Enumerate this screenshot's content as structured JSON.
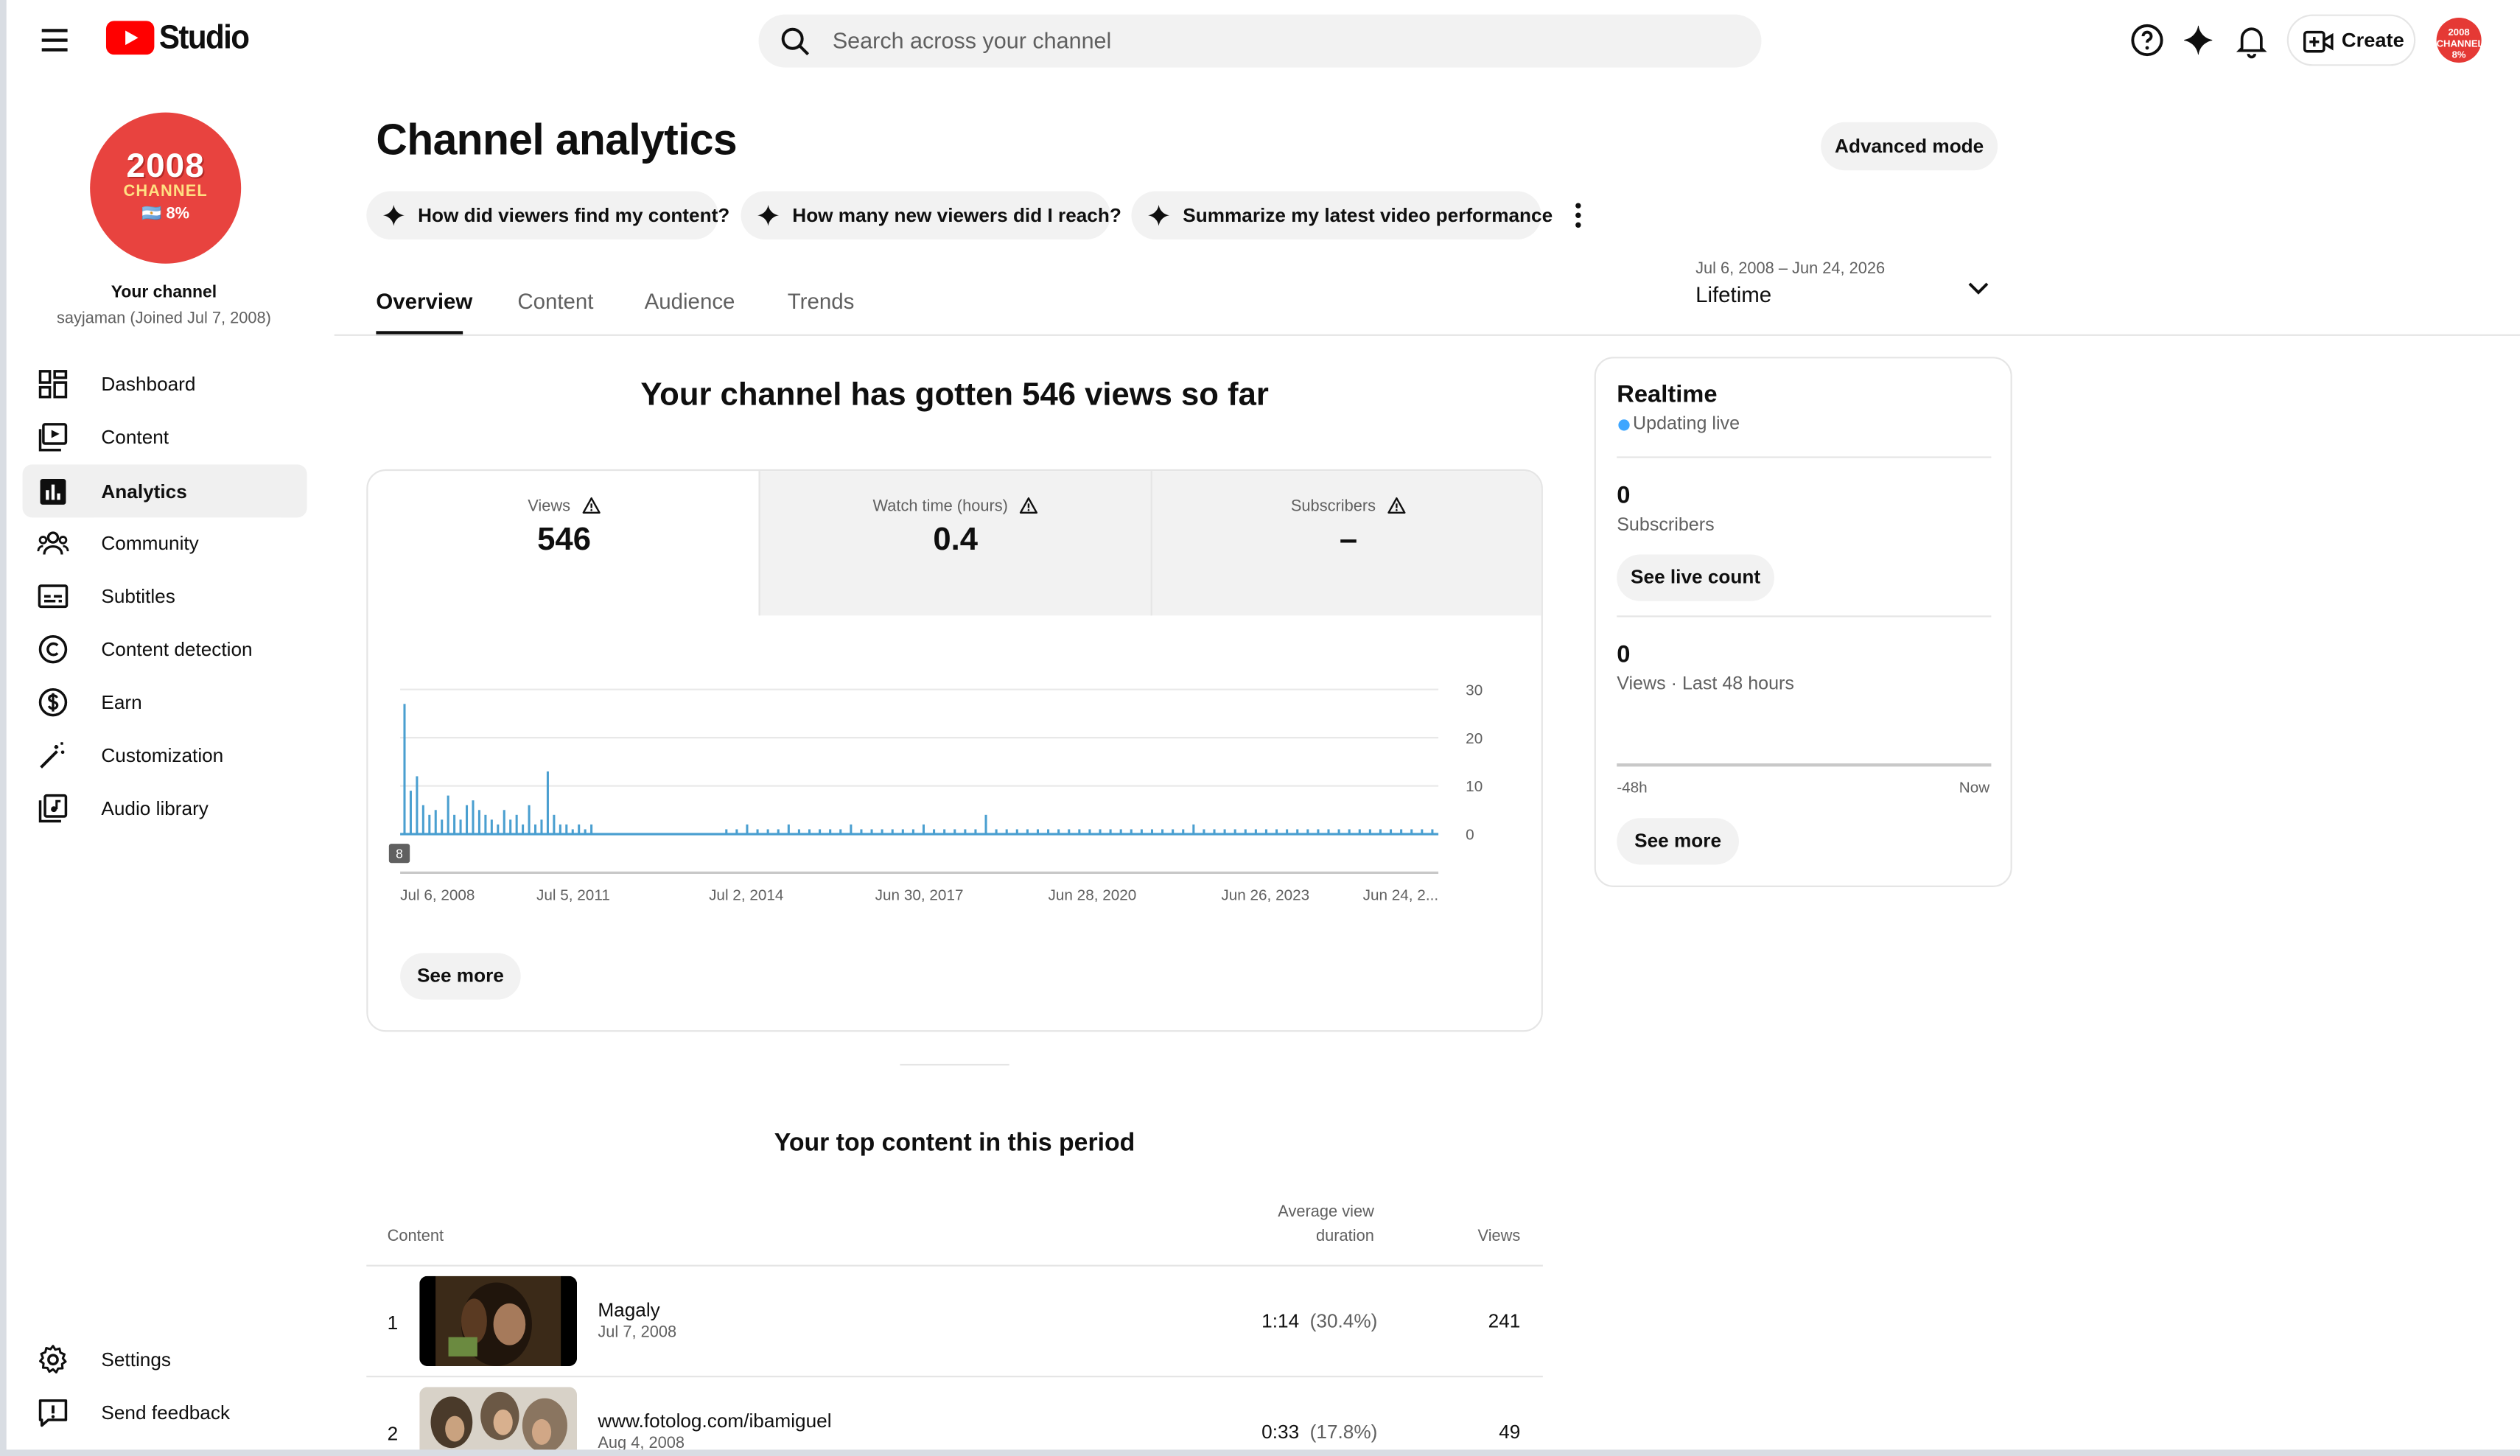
{
  "header": {
    "logo_text": "Studio",
    "search_placeholder": "Search across your channel",
    "create_label": "Create",
    "avatar_text": "2008 CHANNEL 8%"
  },
  "sidebar": {
    "avatar": {
      "line1": "2008",
      "line2": "CHANNEL",
      "line3": "🇦🇷 8%"
    },
    "channel_label": "Your channel",
    "channel_sub": "sayjaman (Joined Jul 7, 2008)",
    "items": [
      {
        "label": "Dashboard",
        "icon": "dashboard-icon"
      },
      {
        "label": "Content",
        "icon": "content-icon"
      },
      {
        "label": "Analytics",
        "icon": "analytics-icon",
        "active": true
      },
      {
        "label": "Community",
        "icon": "community-icon"
      },
      {
        "label": "Subtitles",
        "icon": "subtitles-icon"
      },
      {
        "label": "Content detection",
        "icon": "copyright-icon"
      },
      {
        "label": "Earn",
        "icon": "dollar-icon"
      },
      {
        "label": "Customization",
        "icon": "magic-wand-icon"
      },
      {
        "label": "Audio library",
        "icon": "audio-library-icon"
      }
    ],
    "bottom": [
      {
        "label": "Settings",
        "icon": "gear-icon"
      },
      {
        "label": "Send feedback",
        "icon": "feedback-icon"
      }
    ]
  },
  "main": {
    "title": "Channel analytics",
    "advanced_mode": "Advanced mode",
    "chips": [
      "How did viewers find my content?",
      "How many new viewers did I reach?",
      "Summarize my latest video performance"
    ],
    "date_range": "Jul 6, 2008 – Jun 24, 2026",
    "date_label": "Lifetime",
    "tabs": [
      "Overview",
      "Content",
      "Audience",
      "Trends"
    ],
    "headline": "Your channel has gotten 546 views so far",
    "metrics": [
      {
        "label": "Views",
        "value": "546"
      },
      {
        "label": "Watch time (hours)",
        "value": "0.4"
      },
      {
        "label": "Subscribers",
        "value": "–"
      }
    ],
    "see_more": "See more",
    "top_content_title": "Your top content in this period",
    "table": {
      "col_content": "Content",
      "col_avg_1": "Average view",
      "col_avg_2": "duration",
      "col_views": "Views",
      "rows": [
        {
          "rank": "1",
          "title": "Magaly",
          "date": "Jul 7, 2008",
          "avg": "1:14",
          "pct": "(30.4%)",
          "views": "241"
        },
        {
          "rank": "2",
          "title": "www.fotolog.com/ibamiguel",
          "date": "Aug 4, 2008",
          "avg": "0:33",
          "pct": "(17.8%)",
          "views": "49"
        }
      ]
    }
  },
  "realtime": {
    "title": "Realtime",
    "live": "Updating live",
    "subs_value": "0",
    "subs_label": "Subscribers",
    "live_count_btn": "See live count",
    "views_value": "0",
    "views_label": "Views · Last 48 hours",
    "axis_left": "-48h",
    "axis_right": "Now",
    "see_more": "See more"
  },
  "colors": {
    "brand_red": "#ff0000",
    "chart_blue": "#4a9fd0",
    "live_dot": "#3ea6ff"
  },
  "chart_data": {
    "type": "bar",
    "title": "",
    "series": [
      {
        "values": [
          27,
          9,
          12,
          6,
          4,
          5,
          3,
          8,
          4,
          3,
          6,
          7,
          5,
          4,
          3,
          2,
          5,
          3,
          4,
          2,
          6,
          2,
          3,
          13,
          4,
          2,
          2,
          1,
          2,
          1,
          2,
          1,
          1,
          2,
          1,
          1,
          1,
          2,
          1,
          1,
          1,
          1,
          1,
          2,
          1,
          1,
          1,
          1,
          1,
          1,
          2,
          1,
          1,
          1,
          1,
          1,
          4,
          1,
          1,
          1,
          1,
          1,
          1,
          1,
          1,
          1,
          1,
          1,
          1,
          1,
          1,
          1,
          1,
          1,
          1,
          1,
          2,
          1,
          1,
          1,
          1,
          1,
          1,
          1,
          1,
          1,
          1,
          1,
          1,
          1,
          1,
          1,
          1,
          1,
          1,
          1,
          1,
          1,
          1,
          1
        ]
      }
    ],
    "x_ticks": [
      "Jul 6, 2008",
      "Jul 5, 2011",
      "Jul 2, 2014",
      "Jun 30, 2017",
      "Jun 28, 2020",
      "Jun 26, 2023",
      "Jun 24, 2..."
    ],
    "y_ticks": [
      "30",
      "20",
      "10",
      "0"
    ],
    "ylim": [
      0,
      30
    ],
    "marker_label": "8",
    "grid": true
  }
}
